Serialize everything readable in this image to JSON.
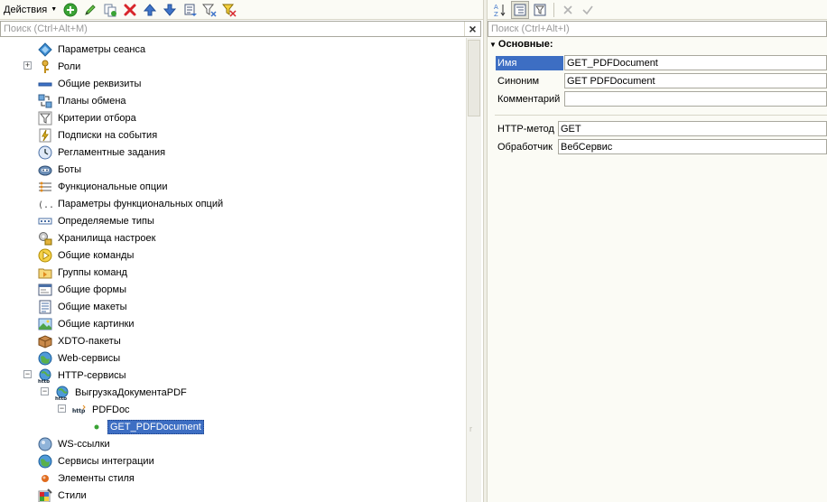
{
  "left_toolbar": {
    "actions_label": "Действия",
    "buttons": [
      {
        "icon": "add-icon",
        "color": "#3aa335"
      },
      {
        "icon": "edit-icon",
        "color": "#3aa335"
      },
      {
        "icon": "copy-icon",
        "color": "#6d8cb4"
      },
      {
        "icon": "delete-icon",
        "color": "#d8262b"
      },
      {
        "icon": "move-up-icon",
        "color": "#3f74c9"
      },
      {
        "icon": "move-down-icon",
        "color": "#3f74c9"
      },
      {
        "icon": "sort-list-icon",
        "color": "#4a5a7a"
      },
      {
        "icon": "filter-icon",
        "color": "#555"
      },
      {
        "icon": "filter-clear-icon",
        "color": "#e0a200"
      }
    ]
  },
  "left_search": {
    "placeholder": "Поиск (Ctrl+Alt+M)",
    "value": "",
    "clear_label": "×"
  },
  "tree": {
    "items": [
      {
        "label": "Параметры сеанса",
        "icon": "session-params-icon"
      },
      {
        "label": "Роли",
        "icon": "roles-icon",
        "expander": "+"
      },
      {
        "label": "Общие реквизиты",
        "icon": "common-attributes-icon"
      },
      {
        "label": "Планы обмена",
        "icon": "exchange-plans-icon"
      },
      {
        "label": "Критерии отбора",
        "icon": "filter-criteria-icon"
      },
      {
        "label": "Подписки на события",
        "icon": "event-subscriptions-icon"
      },
      {
        "label": "Регламентные задания",
        "icon": "scheduled-jobs-icon"
      },
      {
        "label": "Боты",
        "icon": "bots-icon"
      },
      {
        "label": "Функциональные опции",
        "icon": "functional-options-icon"
      },
      {
        "label": "Параметры функциональных опций",
        "icon": "functional-option-params-icon"
      },
      {
        "label": "Определяемые типы",
        "icon": "defined-types-icon"
      },
      {
        "label": "Хранилища настроек",
        "icon": "settings-storages-icon"
      },
      {
        "label": "Общие команды",
        "icon": "common-commands-icon"
      },
      {
        "label": "Группы команд",
        "icon": "command-groups-icon"
      },
      {
        "label": "Общие формы",
        "icon": "common-forms-icon"
      },
      {
        "label": "Общие макеты",
        "icon": "common-templates-icon"
      },
      {
        "label": "Общие картинки",
        "icon": "common-pictures-icon"
      },
      {
        "label": "XDTO-пакеты",
        "icon": "xdto-packages-icon"
      },
      {
        "label": "Web-сервисы",
        "icon": "web-services-icon"
      },
      {
        "label": "HTTP-сервисы",
        "icon": "http-services-icon",
        "expander": "−"
      },
      {
        "label": "ВыгрузкаДокументаPDF",
        "icon": "http-service-icon",
        "expander": "−"
      },
      {
        "label": "PDFDoc",
        "icon": "url-template-icon",
        "expander": "−"
      },
      {
        "label": "GET_PDFDocument",
        "icon": "method-icon",
        "selected": true
      },
      {
        "label": "WS-ссылки",
        "icon": "ws-links-icon"
      },
      {
        "label": "Сервисы интеграции",
        "icon": "integration-services-icon"
      },
      {
        "label": "Элементы стиля",
        "icon": "style-items-icon"
      },
      {
        "label": "Стили",
        "icon": "styles-icon"
      }
    ]
  },
  "right_toolbar": {
    "buttons": [
      {
        "icon": "sort-alpha-icon"
      },
      {
        "icon": "categorized-view-icon"
      },
      {
        "icon": "property-filter-icon"
      },
      {
        "icon": "cancel-icon"
      },
      {
        "icon": "accept-icon"
      }
    ]
  },
  "right_search": {
    "placeholder": "Поиск (Ctrl+Alt+I)",
    "value": ""
  },
  "properties": {
    "section_title": "Основные:",
    "name_label": "Имя",
    "name_value": "GET_PDFDocument",
    "synonym_label": "Синоним",
    "synonym_value": "GET PDFDocument",
    "comment_label": "Комментарий",
    "comment_value": "",
    "http_method_label": "HTTP-метод",
    "http_method_value": "GET",
    "handler_label": "Обработчик",
    "handler_value": "ВебСервис"
  },
  "colors": {
    "selection": "#3d6ec3",
    "toolbar_bg": "#fbfbf5"
  }
}
